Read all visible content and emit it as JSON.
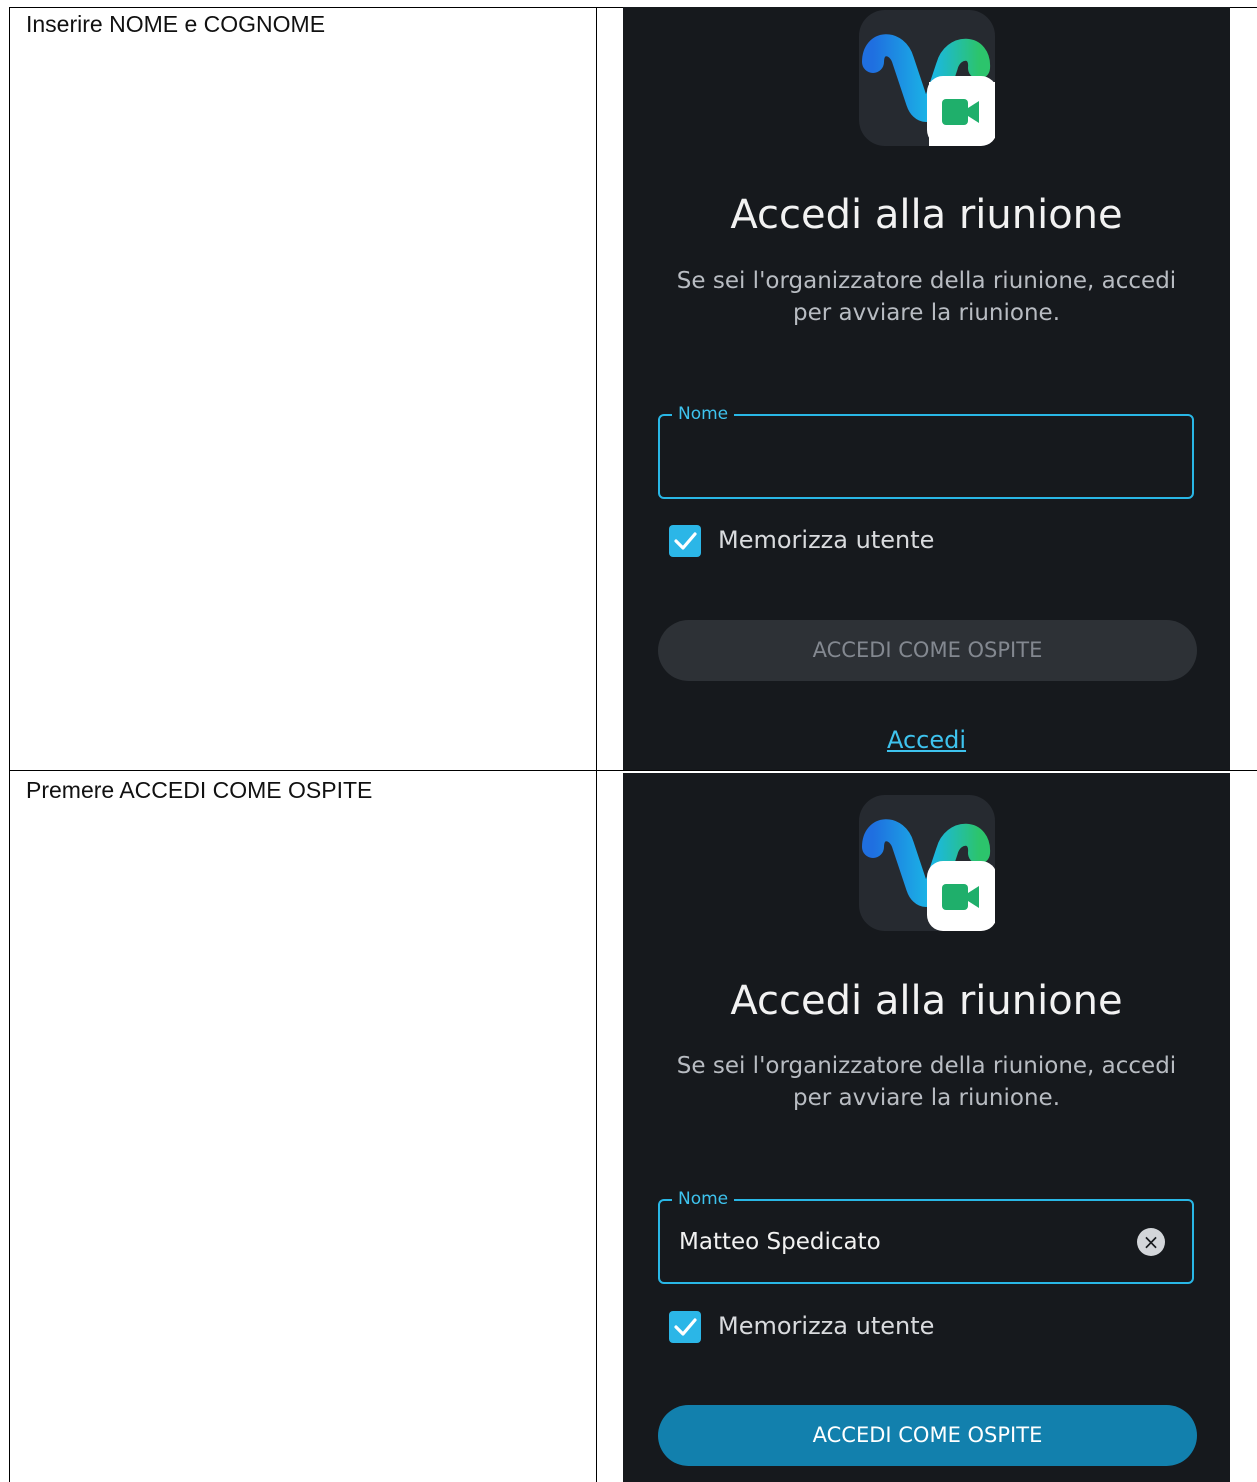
{
  "rows": [
    {
      "instruction": "Inserire NOME e COGNOME",
      "screen": {
        "title": "Accedi alla riunione",
        "subtitle": "Se sei l'organizzatore della riunione, accedi per avviare la riunione.",
        "name_field_label": "Nome",
        "name_field_value": "",
        "remember_label": "Memorizza utente",
        "remember_checked": true,
        "guest_button_label": "ACCEDI COME OSPITE",
        "guest_button_state": "disabled",
        "login_link": "Accedi"
      }
    },
    {
      "instruction": "Premere ACCEDI COME OSPITE",
      "screen": {
        "title": "Accedi alla riunione",
        "subtitle": "Se sei l'organizzatore della riunione, accedi per avviare la riunione.",
        "name_field_label": "Nome",
        "name_field_value": "Matteo Spedicato",
        "clear_icon": "clear-icon",
        "remember_label": "Memorizza utente",
        "remember_checked": true,
        "guest_button_label": "ACCEDI COME OSPITE",
        "guest_button_state": "enabled"
      }
    }
  ],
  "colors": {
    "screen_background": "#16191d",
    "accent": "#29b7e6",
    "primary_button": "#1280ad",
    "disabled_button": "#2d3136",
    "app_icon_green": "#1faf6b"
  }
}
